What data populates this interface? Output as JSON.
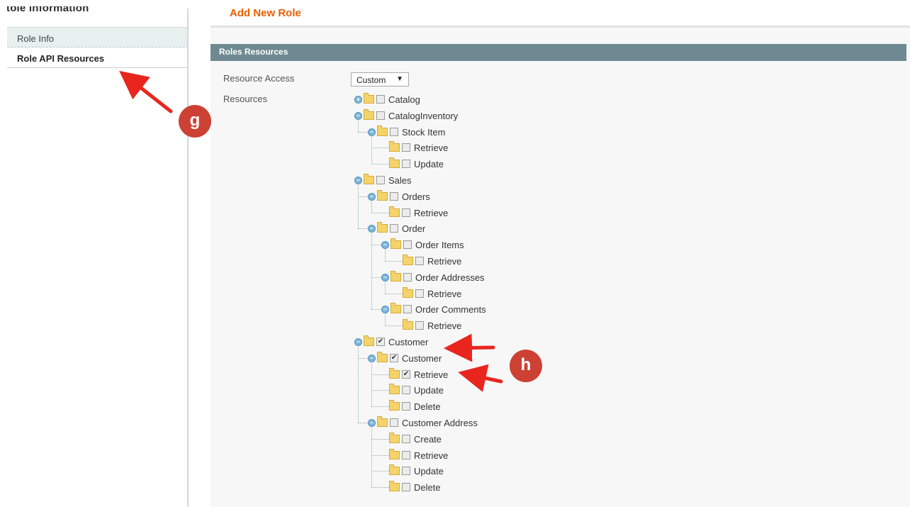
{
  "sidebar": {
    "title": "tole information",
    "tabs": [
      {
        "label": "Role Info"
      },
      {
        "label": "Role API Resources"
      }
    ]
  },
  "page": {
    "title": "Add New Role",
    "section_title": "Roles Resources",
    "resource_access_label": "Resource Access",
    "resource_access_value": "Custom",
    "resources_label": "Resources"
  },
  "tree": [
    {
      "label": "Catalog",
      "checked": false,
      "expander": "+"
    },
    {
      "label": "CatalogInventory",
      "checked": false,
      "expander": "−"
    },
    {
      "label": "Stock Item",
      "checked": false,
      "expander": "−"
    },
    {
      "label": "Retrieve",
      "checked": false
    },
    {
      "label": "Update",
      "checked": false
    },
    {
      "label": "Sales",
      "checked": false,
      "expander": "−"
    },
    {
      "label": "Orders",
      "checked": false,
      "expander": "−"
    },
    {
      "label": "Retrieve",
      "checked": false
    },
    {
      "label": "Order",
      "checked": false,
      "expander": "−"
    },
    {
      "label": "Order Items",
      "checked": false,
      "expander": "−"
    },
    {
      "label": "Retrieve",
      "checked": false
    },
    {
      "label": "Order Addresses",
      "checked": false,
      "expander": "−"
    },
    {
      "label": "Retrieve",
      "checked": false
    },
    {
      "label": "Order Comments",
      "checked": false,
      "expander": "−"
    },
    {
      "label": "Retrieve",
      "checked": false
    },
    {
      "label": "Customer",
      "checked": true,
      "expander": "−"
    },
    {
      "label": "Customer",
      "checked": true,
      "expander": "−"
    },
    {
      "label": "Retrieve",
      "checked": true
    },
    {
      "label": "Update",
      "checked": false
    },
    {
      "label": "Delete",
      "checked": false
    },
    {
      "label": "Customer Address",
      "checked": false,
      "expander": "−"
    },
    {
      "label": "Create",
      "checked": false
    },
    {
      "label": "Retrieve",
      "checked": false
    },
    {
      "label": "Update",
      "checked": false
    },
    {
      "label": "Delete",
      "checked": false
    }
  ],
  "annotations": {
    "badge_g": "g",
    "badge_h": "h",
    "color": "#cc4133"
  },
  "colors": {
    "accent_title": "#eb5e00",
    "section_bar": "#6f8992"
  }
}
